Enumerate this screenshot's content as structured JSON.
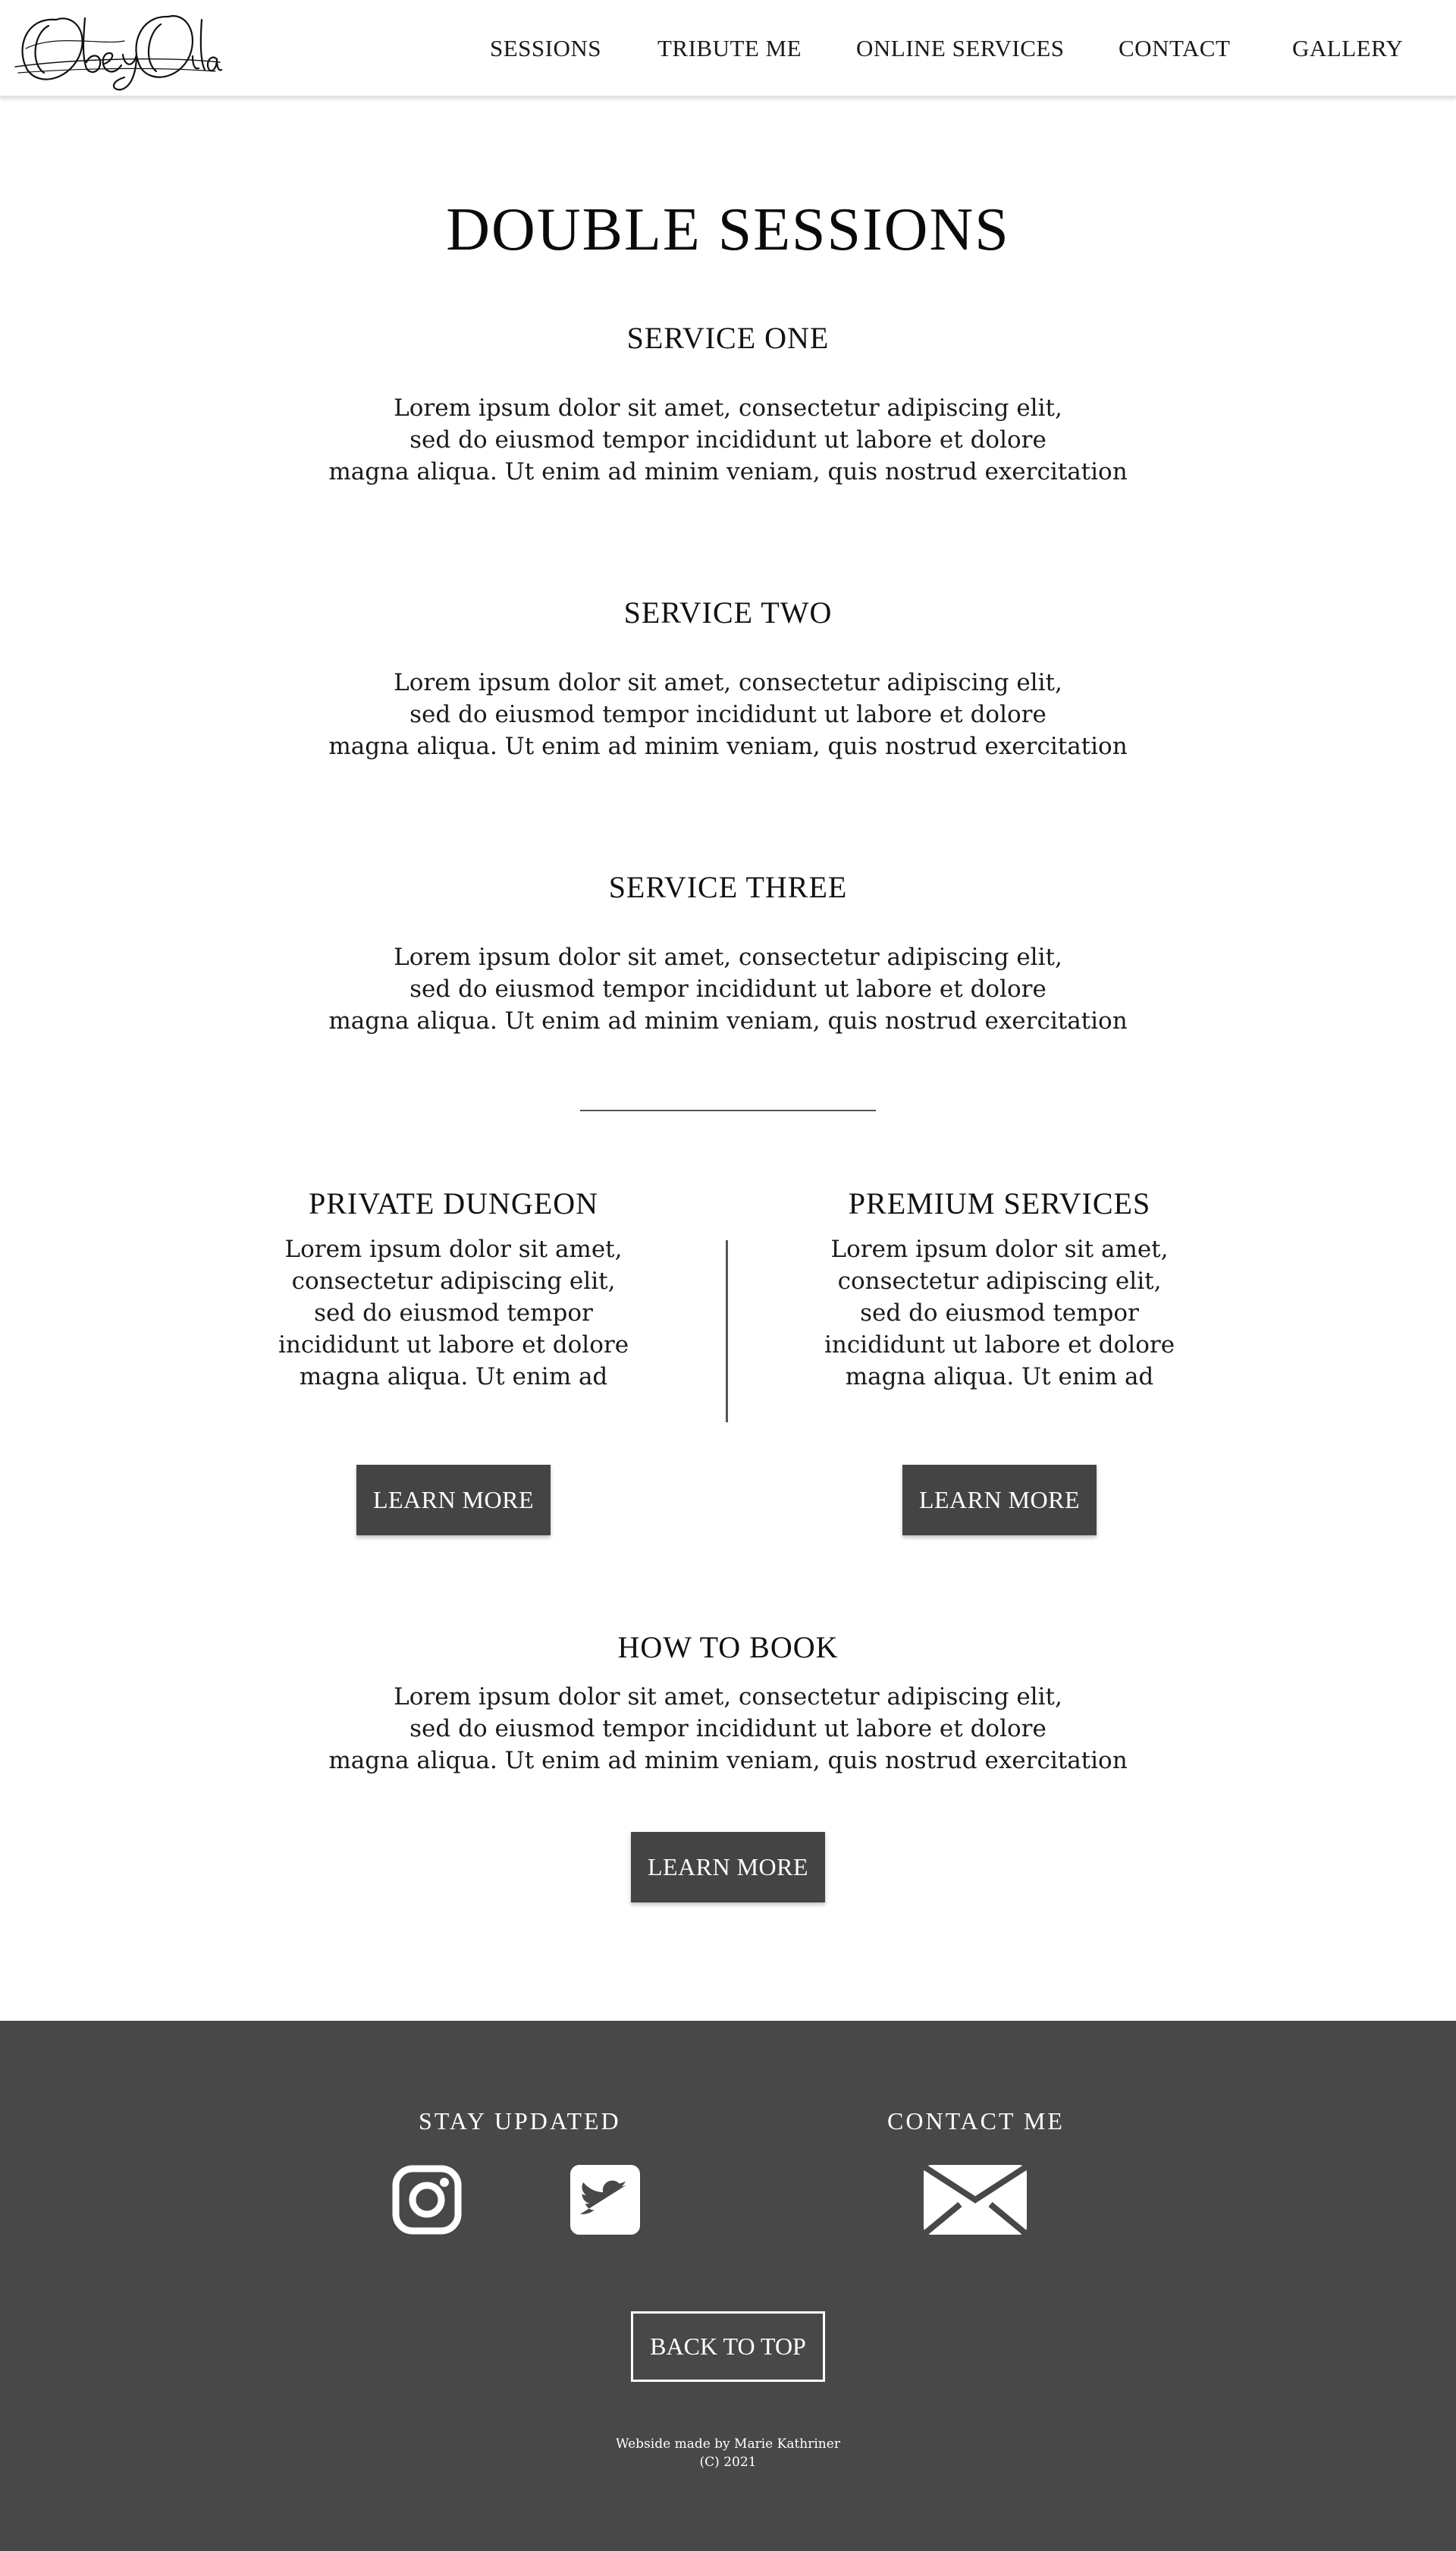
{
  "header": {
    "logo_text": "Obey Oila",
    "nav": [
      "SESSIONS",
      "TRIBUTE ME",
      "ONLINE SERVICES",
      "CONTACT",
      "GALLERY"
    ]
  },
  "main": {
    "title": "DOUBLE SESSIONS",
    "services": [
      {
        "heading": "SERVICE ONE",
        "lines": [
          "Lorem ipsum dolor sit amet, consectetur adipiscing elit,",
          "sed do eiusmod tempor incididunt ut labore et dolore",
          "magna aliqua. Ut enim ad minim veniam, quis nostrud exercitation"
        ]
      },
      {
        "heading": "SERVICE TWO",
        "lines": [
          "Lorem ipsum dolor sit amet, consectetur adipiscing elit,",
          "sed do eiusmod tempor incididunt ut labore et dolore",
          "magna aliqua. Ut enim ad minim veniam, quis nostrud exercitation"
        ]
      },
      {
        "heading": "SERVICE THREE",
        "lines": [
          "Lorem ipsum dolor sit amet, consectetur adipiscing elit,",
          "sed do eiusmod tempor incididunt ut labore et dolore",
          "magna aliqua. Ut enim ad minim veniam, quis nostrud exercitation"
        ]
      }
    ],
    "columns": [
      {
        "heading": "PRIVATE DUNGEON",
        "lines": [
          "Lorem ipsum dolor sit amet,",
          "consectetur adipiscing elit,",
          "sed do eiusmod tempor",
          "incididunt ut labore et dolore",
          "magna aliqua. Ut enim ad"
        ],
        "button": "LEARN MORE"
      },
      {
        "heading": "PREMIUM SERVICES",
        "lines": [
          "Lorem ipsum dolor sit amet,",
          "consectetur adipiscing elit,",
          "sed do eiusmod tempor",
          "incididunt ut labore et dolore",
          "magna aliqua. Ut enim ad"
        ],
        "button": "LEARN MORE"
      }
    ],
    "how_to_book": {
      "heading": "HOW TO BOOK",
      "lines": [
        "Lorem ipsum dolor sit amet, consectetur adipiscing elit,",
        "sed do eiusmod tempor incididunt ut labore et dolore",
        "magna aliqua. Ut enim ad minim veniam, quis nostrud exercitation"
      ],
      "button": "LEARN MORE"
    }
  },
  "footer": {
    "stay_updated": "STAY UPDATED",
    "contact_me": "CONTACT ME",
    "icons": [
      "instagram-icon",
      "twitter-icon",
      "mail-icon"
    ],
    "back_to_top": "BACK TO TOP",
    "credit_line1": "Webside made by Marie Kathriner",
    "credit_line2": "(C) 2021"
  },
  "colors": {
    "button_bg": "#444444",
    "footer_bg": "#484848",
    "text": "#111111",
    "background": "#ffffff"
  }
}
